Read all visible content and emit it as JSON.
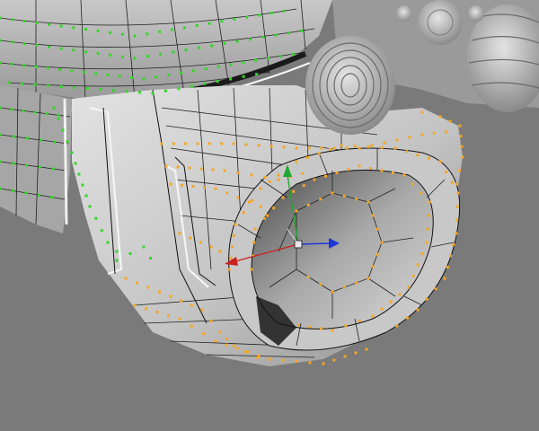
{
  "viewport": {
    "background_color": "#7a7a7a",
    "mesh_light_color": "#e6e6e6",
    "mesh_mid_color": "#b9b9b9",
    "mesh_dark_color": "#3a3a3a",
    "wire_color": "#111111",
    "selected_vertex_color": "#f5a623",
    "unselected_vertex_color": "#34d62a",
    "objects": [
      "helmet-dome",
      "respirator-mask",
      "mask-opening",
      "breathing-canister"
    ]
  },
  "manipulator": {
    "name": "move-manipulator",
    "axes": [
      {
        "axis": "x",
        "color": "#cc1f1f"
      },
      {
        "axis": "y",
        "color": "#1fa82f"
      },
      {
        "axis": "z",
        "color": "#1f35d6"
      }
    ],
    "center_handle_color": "#e8e8e8"
  }
}
